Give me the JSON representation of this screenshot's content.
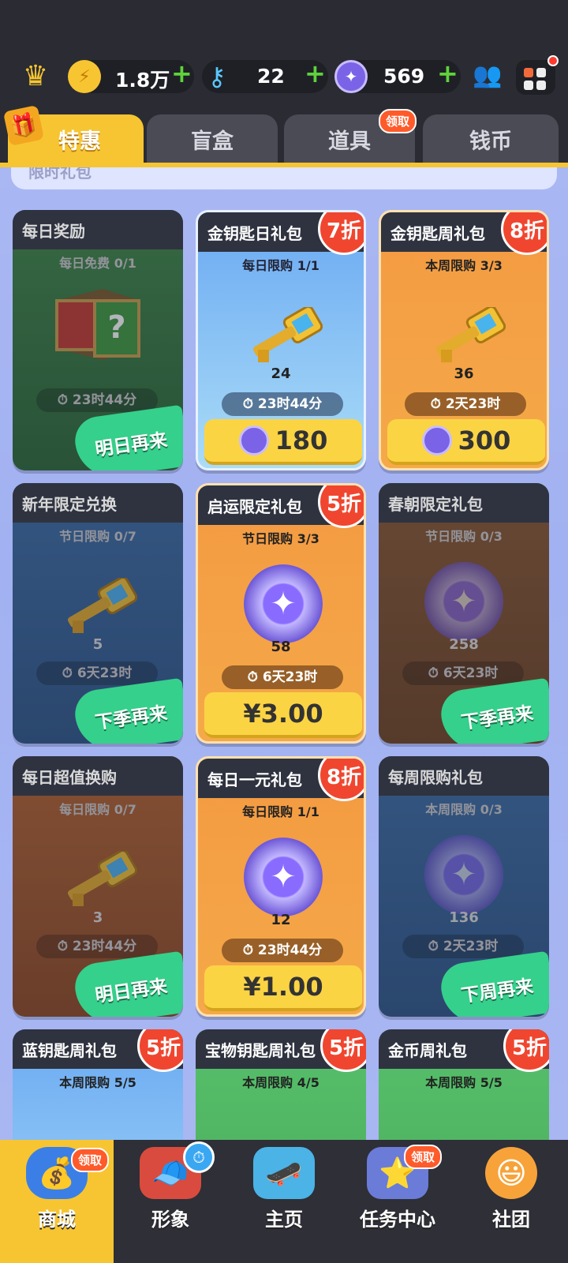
{
  "resources": {
    "gold": "1.8万",
    "keys": "22",
    "coins": "569",
    "plus": "+"
  },
  "tabs": [
    {
      "label": "特惠",
      "active": true
    },
    {
      "label": "盲盒"
    },
    {
      "label": "道具",
      "badge": "领取"
    },
    {
      "label": "钱币"
    }
  ],
  "section_title": "限时礼包",
  "cards": [
    {
      "title": "每日奖励",
      "limit": "每日免费 0/1",
      "timer": "23时44分",
      "stamp": "明日再来",
      "item": "mystery-box"
    },
    {
      "title": "金钥匙日礼包",
      "discount": "7折",
      "limit": "每日限购 1/1",
      "count": "24",
      "timer": "23时44分",
      "price": "180",
      "item": "gold-key"
    },
    {
      "title": "金钥匙周礼包",
      "discount": "8折",
      "limit": "本周限购 3/3",
      "count": "36",
      "timer": "2天23时",
      "price": "300",
      "item": "gold-key"
    },
    {
      "title": "新年限定兑换",
      "limit": "节日限购 0/7",
      "count": "5",
      "timer": "6天23时",
      "stamp": "下季再来",
      "item": "gold-key"
    },
    {
      "title": "启运限定礼包",
      "discount": "5折",
      "limit": "节日限购 3/3",
      "count": "58",
      "timer": "6天23时",
      "price": "¥3.00",
      "item": "coin"
    },
    {
      "title": "春朝限定礼包",
      "limit": "节日限购 0/3",
      "count": "258",
      "timer": "6天23时",
      "stamp": "下季再来",
      "item": "coin"
    },
    {
      "title": "每日超值换购",
      "limit": "每日限购 0/7",
      "count": "3",
      "timer": "23时44分",
      "stamp": "明日再来",
      "item": "gold-key"
    },
    {
      "title": "每日一元礼包",
      "discount": "8折",
      "limit": "每日限购 1/1",
      "count": "12",
      "timer": "23时44分",
      "price": "¥1.00",
      "item": "coin"
    },
    {
      "title": "每周限购礼包",
      "limit": "本周限购 0/3",
      "count": "136",
      "timer": "2天23时",
      "stamp": "下周再来",
      "item": "coin"
    },
    {
      "title": "蓝钥匙周礼包",
      "discount": "5折",
      "limit": "本周限购 5/5"
    },
    {
      "title": "宝物钥匙周礼包",
      "discount": "5折",
      "limit": "本周限购 4/5"
    },
    {
      "title": "金币周礼包",
      "discount": "5折",
      "limit": "本周限购 5/5"
    }
  ],
  "nav": [
    {
      "label": "商城",
      "badge": "领取",
      "active": true
    },
    {
      "label": "形象"
    },
    {
      "label": "主页"
    },
    {
      "label": "任务中心",
      "badge": "领取"
    },
    {
      "label": "社团"
    }
  ],
  "colors": {
    "accent": "#f7c531",
    "discount": "#f0462f",
    "splash": "#35d08b"
  }
}
